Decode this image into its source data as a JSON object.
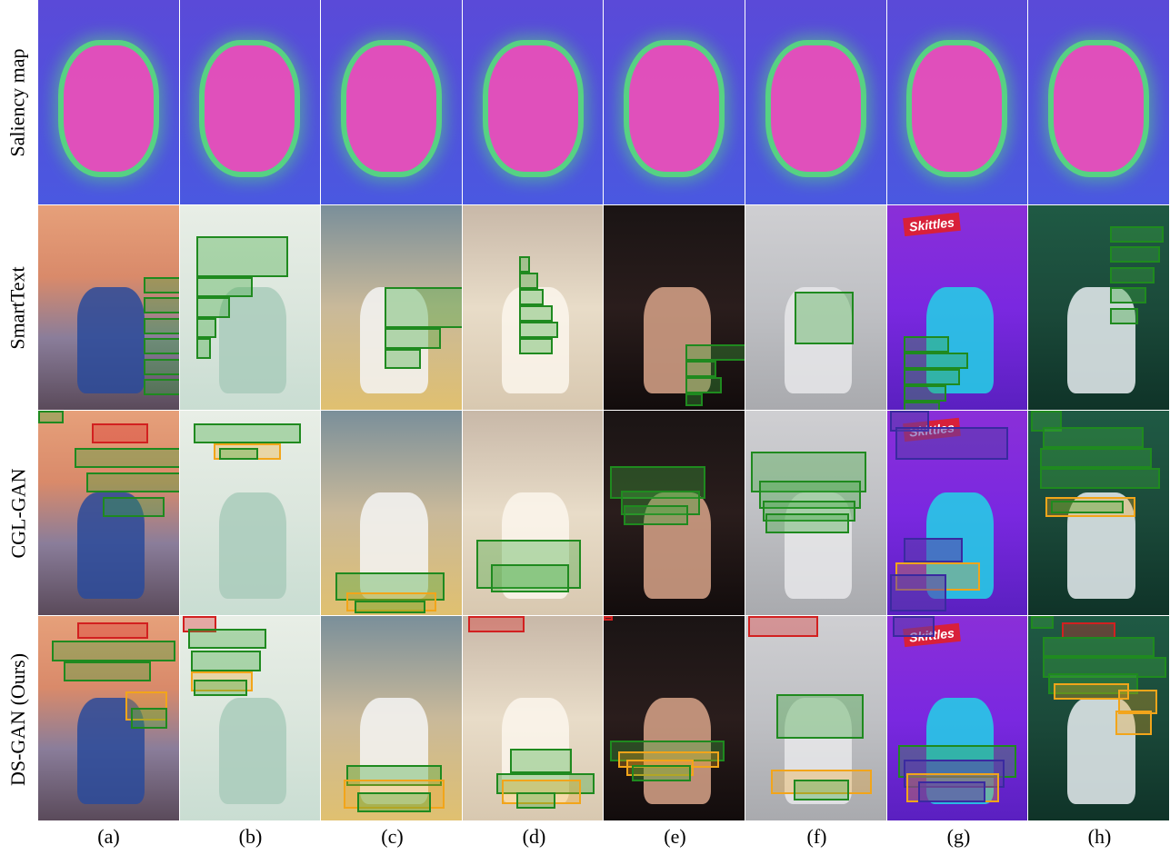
{
  "row_labels": [
    "Saliency map",
    "SmartText",
    "CGL-GAN",
    "DS-GAN (Ours)"
  ],
  "column_captions": [
    "(a)",
    "(b)",
    "(c)",
    "(d)",
    "(e)",
    "(f)",
    "(g)",
    "(h)"
  ],
  "image_text": {
    "skittles_label": "Skittles"
  },
  "columns": [
    {
      "bg": "linear-gradient(180deg,#e6a07a 0%,#d98a6a 35%,#8a7d9a 65%,#5a4a5a 100%)",
      "accent": "#2a4a9a"
    },
    {
      "bg": "linear-gradient(180deg,#e8eee6 0%,#dbe6dd 50%,#c9ddd2 100%)",
      "accent": "#a9cbbb"
    },
    {
      "bg": "linear-gradient(180deg,#7a8f9a 0%,#c9b99a 50%,#e0c070 100%)",
      "accent": "#f4f4f4"
    },
    {
      "bg": "linear-gradient(180deg,#c8b8a8 0%,#e8dcc8 50%,#d8c8b0 100%)",
      "accent": "#fbf6ec"
    },
    {
      "bg": "linear-gradient(180deg,#1a1414 0%,#2a1d1c 50%,#120c0c 100%)",
      "accent": "#d9a58a"
    },
    {
      "bg": "linear-gradient(180deg,#cfcfd2 0%,#bfc0c4 50%,#a9aaae 100%)",
      "accent": "#e8e8ea"
    },
    {
      "bg": "linear-gradient(180deg,#8a2fd8 0%,#7a28e0 50%,#5a20c0 100%)",
      "accent": "#22d3e6"
    },
    {
      "bg": "linear-gradient(180deg,#1f5a44 0%,#1b4a3a 50%,#0f3328 100%)",
      "accent": "#e9eef2"
    }
  ],
  "saliency_bg": "linear-gradient(180deg,#5a4ad8 0%,#4a58e0 100%)",
  "saliency_hot": "#f050b8",
  "saliency_edge": "#58e07a",
  "boxes": {
    "row1": [
      [
        [
          75,
          35,
          58,
          8,
          "green"
        ],
        [
          75,
          45,
          44,
          8,
          "green"
        ],
        [
          75,
          55,
          40,
          8,
          "green"
        ],
        [
          75,
          65,
          44,
          8,
          "green"
        ],
        [
          75,
          75,
          52,
          8,
          "green"
        ],
        [
          75,
          85,
          40,
          8,
          "green"
        ]
      ],
      [
        [
          12,
          15,
          65,
          20,
          "green"
        ],
        [
          12,
          35,
          40,
          10,
          "green"
        ],
        [
          12,
          45,
          24,
          10,
          "green"
        ],
        [
          12,
          55,
          14,
          10,
          "green"
        ],
        [
          12,
          65,
          10,
          10,
          "green"
        ]
      ],
      [
        [
          45,
          40,
          92,
          20,
          "green"
        ],
        [
          45,
          60,
          40,
          10,
          "green"
        ],
        [
          45,
          70,
          26,
          10,
          "green"
        ]
      ],
      [
        [
          40,
          25,
          8,
          8,
          "green"
        ],
        [
          40,
          33,
          14,
          8,
          "green"
        ],
        [
          40,
          41,
          18,
          8,
          "green"
        ],
        [
          40,
          49,
          24,
          8,
          "green"
        ],
        [
          40,
          57,
          28,
          8,
          "green"
        ],
        [
          40,
          65,
          24,
          8,
          "green"
        ]
      ],
      [
        [
          58,
          68,
          44,
          8,
          "green"
        ],
        [
          58,
          76,
          22,
          8,
          "green"
        ],
        [
          58,
          84,
          26,
          8,
          "green"
        ],
        [
          58,
          92,
          12,
          6,
          "green"
        ]
      ],
      [
        [
          35,
          42,
          42,
          26,
          "green"
        ]
      ],
      [
        [
          12,
          64,
          32,
          8,
          "green"
        ],
        [
          12,
          72,
          46,
          8,
          "green"
        ],
        [
          12,
          80,
          40,
          8,
          "green"
        ],
        [
          12,
          88,
          30,
          8,
          "green"
        ],
        [
          12,
          96,
          26,
          6,
          "green"
        ]
      ],
      [
        [
          58,
          10,
          38,
          8,
          "green"
        ],
        [
          58,
          20,
          36,
          8,
          "green"
        ],
        [
          58,
          30,
          32,
          8,
          "green"
        ],
        [
          58,
          40,
          26,
          8,
          "green"
        ],
        [
          58,
          50,
          20,
          8,
          "green"
        ]
      ]
    ],
    "row2": [
      [
        [
          0,
          0,
          18,
          6,
          "green"
        ],
        [
          38,
          6,
          40,
          10,
          "red"
        ],
        [
          26,
          18,
          82,
          10,
          "green"
        ],
        [
          34,
          30,
          68,
          10,
          "green"
        ],
        [
          46,
          42,
          44,
          10,
          "green"
        ]
      ],
      [
        [
          10,
          6,
          76,
          10,
          "green"
        ],
        [
          24,
          16,
          48,
          8,
          "orange"
        ],
        [
          28,
          18,
          28,
          6,
          "green"
        ]
      ],
      [
        [
          10,
          79,
          78,
          14,
          "green"
        ],
        [
          18,
          89,
          64,
          9,
          "orange"
        ],
        [
          24,
          93,
          50,
          6,
          "green"
        ]
      ],
      [
        [
          10,
          63,
          74,
          24,
          "green"
        ],
        [
          20,
          75,
          56,
          14,
          "green"
        ]
      ],
      [
        [
          4,
          27,
          68,
          16,
          "green"
        ],
        [
          12,
          39,
          56,
          12,
          "green"
        ],
        [
          14,
          46,
          46,
          10,
          "green"
        ]
      ],
      [
        [
          4,
          20,
          82,
          20,
          "green"
        ],
        [
          10,
          34,
          72,
          14,
          "green"
        ],
        [
          12,
          44,
          66,
          10,
          "green"
        ],
        [
          14,
          50,
          60,
          10,
          "green"
        ]
      ],
      [
        [
          2,
          0,
          28,
          10,
          "purple"
        ],
        [
          6,
          8,
          80,
          16,
          "purple"
        ],
        [
          12,
          62,
          42,
          12,
          "purple"
        ],
        [
          6,
          74,
          60,
          14,
          "orange"
        ],
        [
          2,
          80,
          40,
          18,
          "purple"
        ]
      ],
      [
        [
          2,
          0,
          22,
          10,
          "green"
        ],
        [
          10,
          8,
          72,
          10,
          "green"
        ],
        [
          8,
          18,
          80,
          10,
          "green"
        ],
        [
          8,
          28,
          86,
          10,
          "green"
        ],
        [
          12,
          42,
          64,
          10,
          "orange"
        ],
        [
          16,
          44,
          52,
          6,
          "green"
        ]
      ]
    ],
    "row3": [
      [
        [
          28,
          3,
          50,
          8,
          "red"
        ],
        [
          10,
          12,
          88,
          10,
          "green"
        ],
        [
          18,
          22,
          62,
          10,
          "green"
        ],
        [
          62,
          37,
          30,
          14,
          "orange"
        ],
        [
          66,
          45,
          26,
          10,
          "green"
        ]
      ],
      [
        [
          2,
          0,
          24,
          8,
          "red"
        ],
        [
          6,
          6,
          56,
          10,
          "green"
        ],
        [
          8,
          17,
          50,
          10,
          "green"
        ],
        [
          8,
          27,
          44,
          10,
          "orange"
        ],
        [
          10,
          31,
          38,
          8,
          "green"
        ]
      ],
      [
        [
          18,
          73,
          68,
          10,
          "green"
        ],
        [
          16,
          80,
          72,
          14,
          "orange"
        ],
        [
          26,
          86,
          52,
          10,
          "green"
        ]
      ],
      [
        [
          4,
          0,
          40,
          8,
          "red"
        ],
        [
          34,
          65,
          44,
          12,
          "green"
        ],
        [
          24,
          77,
          70,
          10,
          "green"
        ],
        [
          28,
          80,
          56,
          12,
          "orange"
        ],
        [
          38,
          86,
          28,
          8,
          "green"
        ]
      ],
      [
        [
          0,
          0,
          6,
          2,
          "red"
        ],
        [
          4,
          61,
          82,
          10,
          "green"
        ],
        [
          10,
          66,
          72,
          8,
          "orange"
        ],
        [
          16,
          70,
          48,
          8,
          "orange"
        ],
        [
          20,
          73,
          42,
          8,
          "green"
        ]
      ],
      [
        [
          2,
          0,
          50,
          10,
          "red"
        ],
        [
          22,
          38,
          62,
          22,
          "green"
        ],
        [
          18,
          75,
          72,
          12,
          "orange"
        ],
        [
          34,
          80,
          40,
          10,
          "green"
        ]
      ],
      [
        [
          4,
          0,
          30,
          10,
          "purple"
        ],
        [
          8,
          63,
          84,
          16,
          "green"
        ],
        [
          12,
          70,
          72,
          14,
          "purple"
        ],
        [
          14,
          77,
          66,
          14,
          "orange"
        ],
        [
          22,
          81,
          48,
          10,
          "purple"
        ]
      ],
      [
        [
          2,
          0,
          16,
          6,
          "green"
        ],
        [
          24,
          3,
          38,
          8,
          "red"
        ],
        [
          10,
          10,
          80,
          10,
          "green"
        ],
        [
          10,
          20,
          88,
          10,
          "green"
        ],
        [
          14,
          28,
          64,
          10,
          "green"
        ],
        [
          18,
          33,
          54,
          8,
          "orange"
        ],
        [
          64,
          36,
          28,
          12,
          "orange"
        ],
        [
          62,
          46,
          26,
          12,
          "orange"
        ]
      ]
    ]
  }
}
